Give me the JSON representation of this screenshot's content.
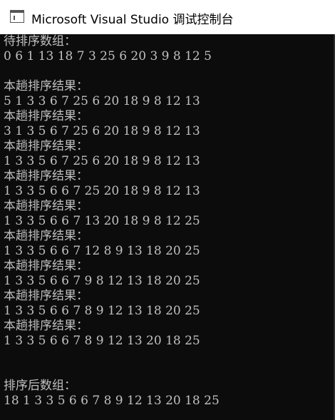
{
  "window": {
    "title": "Microsoft Visual Studio 调试控制台",
    "icon": "console-window-icon"
  },
  "console": {
    "lines": [
      "待排序数组：",
      "0 6 1 13 18 7 3 25 6 20 3 9 8 12 5",
      "",
      "本趟排序结果：",
      "5 1 3 3 6 7 25 6 20 18 9 8 12 13",
      "本趟排序结果：",
      "3 1 3 5 6 7 25 6 20 18 9 8 12 13",
      "本趟排序结果：",
      "1 3 3 5 6 7 25 6 20 18 9 8 12 13",
      "本趟排序结果：",
      "1 3 3 5 6 6 7 25 20 18 9 8 12 13",
      "本趟排序结果：",
      "1 3 3 5 6 6 7 13 20 18 9 8 12 25",
      "本趟排序结果：",
      "1 3 3 5 6 6 7 12 8 9 13 18 20 25",
      "本趟排序结果：",
      "1 3 3 5 6 6 7 9 8 12 13 18 20 25",
      "本趟排序结果：",
      "1 3 3 5 6 6 7 8 9 12 13 18 20 25",
      "本趟排序结果：",
      "1 3 3 5 6 6 7 8 9 12 13 20 18 25",
      "",
      "",
      "排序后数组：",
      "18 1 3 3 5 6 6 7 8 9 12 13 20 18 25"
    ]
  }
}
